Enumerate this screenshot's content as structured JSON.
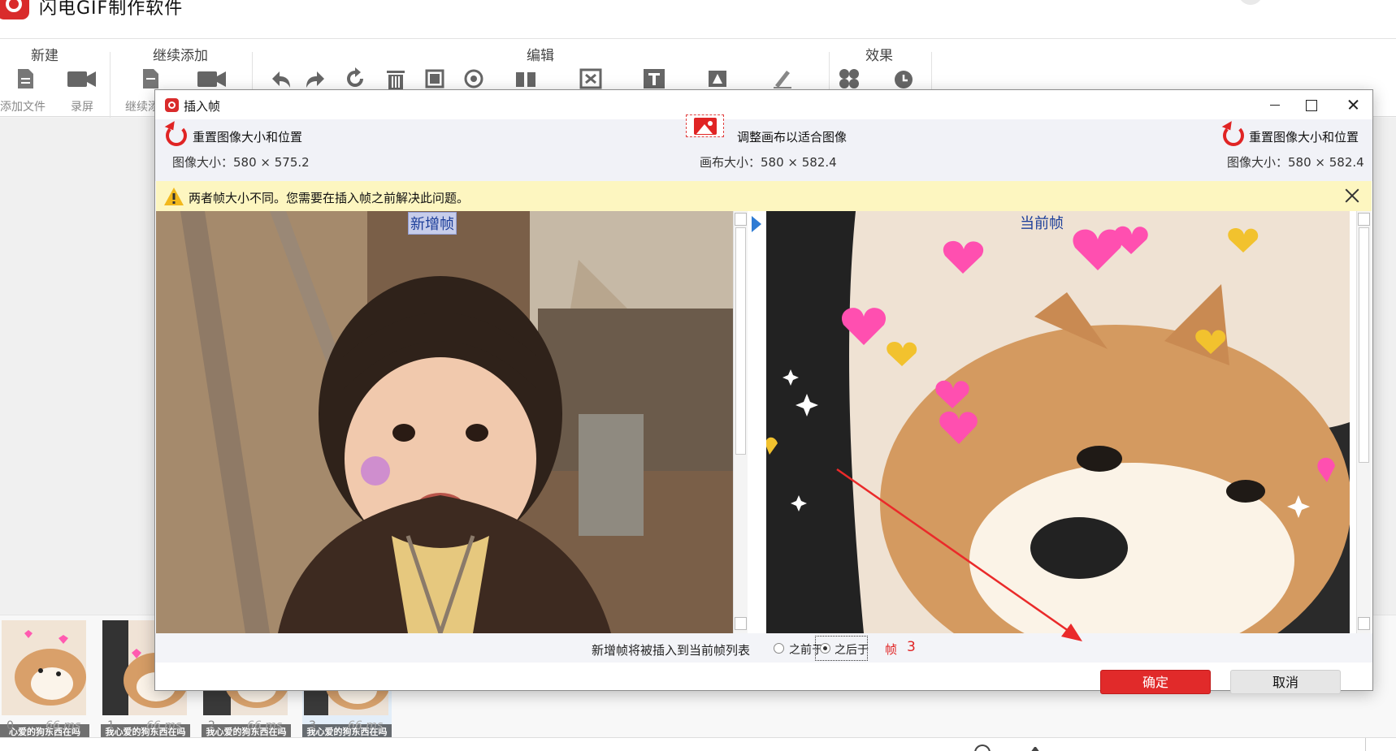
{
  "app": {
    "title": "闪电GIF制作软件"
  },
  "ribbon": {
    "groups": {
      "new": "新建",
      "continue_add": "继续添加",
      "edit": "编辑",
      "effects": "效果"
    },
    "tools": {
      "add_file": "添加文件",
      "record_screen": "录屏",
      "continue_add": "继续添"
    }
  },
  "dialog": {
    "title": "插入帧",
    "left_reset_label": "重置图像大小和位置",
    "left_image_size": "图像大小：580 × 575.2",
    "fit_label": "调整画布以适合图像",
    "canvas_size": "画布大小：580 × 582.4",
    "right_reset_label": "重置图像大小和位置",
    "right_image_size": "图像大小：580 × 582.4",
    "warning": "两者帧大小不同。您需要在插入帧之前解决此问题。",
    "left_pane_title": "新增帧",
    "right_pane_title": "当前帧",
    "insert_prompt": "新增帧将被插入到当前帧列表",
    "option_before": "之前于",
    "option_after": "之后于",
    "selected_option": "之后于",
    "frame_label": "帧",
    "frame_number": "3",
    "ok": "确定",
    "cancel": "取消"
  },
  "filmstrip": {
    "frames": [
      {
        "index": "0",
        "duration": "66 ms",
        "caption": "心爱的狗东西在吗"
      },
      {
        "index": "1",
        "duration": "66 ms",
        "caption": "我心爱的狗东西在吗"
      },
      {
        "index": "2",
        "duration": "66 ms",
        "caption": "我心爱的狗东西在吗"
      },
      {
        "index": "3",
        "duration": "66 ms",
        "caption": "我心爱的狗东西在吗"
      }
    ]
  },
  "colors": {
    "accent": "#e12a2a",
    "warning_bg": "#fdf6c0",
    "selection": "#e3eef9"
  }
}
